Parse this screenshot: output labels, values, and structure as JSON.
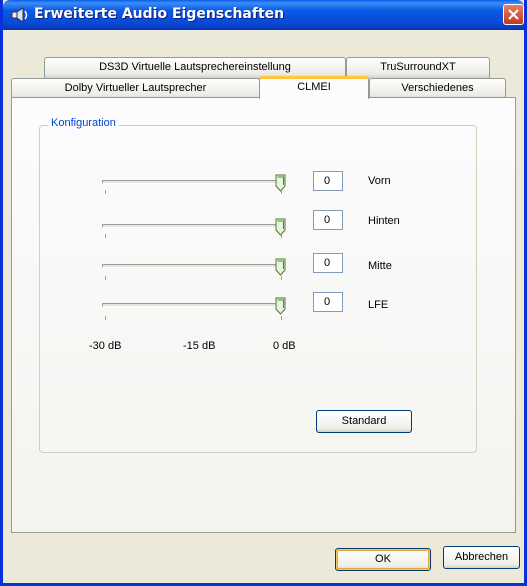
{
  "window": {
    "title": "Erweiterte Audio Eigenschaften",
    "icon": "speaker-icon"
  },
  "tabs": {
    "row1": [
      "DS3D Virtuelle Lautsprechereinstellung",
      "TruSurroundXT"
    ],
    "row2": [
      "Dolby Virtueller Lautsprecher",
      "CLMEI",
      "Verschiedenes"
    ],
    "active": "CLMEI"
  },
  "group": {
    "label": "Konfiguration"
  },
  "channels": [
    {
      "label": "Vorn",
      "value": "0"
    },
    {
      "label": "Hinten",
      "value": "0"
    },
    {
      "label": "Mitte",
      "value": "0"
    },
    {
      "label": "LFE",
      "value": "0"
    }
  ],
  "scale": {
    "min": "-30 dB",
    "mid": "-15 dB",
    "max": "0 dB"
  },
  "buttons": {
    "standard": "Standard",
    "ok": "OK",
    "cancel": "Abbrechen"
  },
  "colors": {
    "title_bar": "#0A5AE5",
    "group_label": "#0046D5",
    "active_tab_accent": "#FFC83C"
  }
}
